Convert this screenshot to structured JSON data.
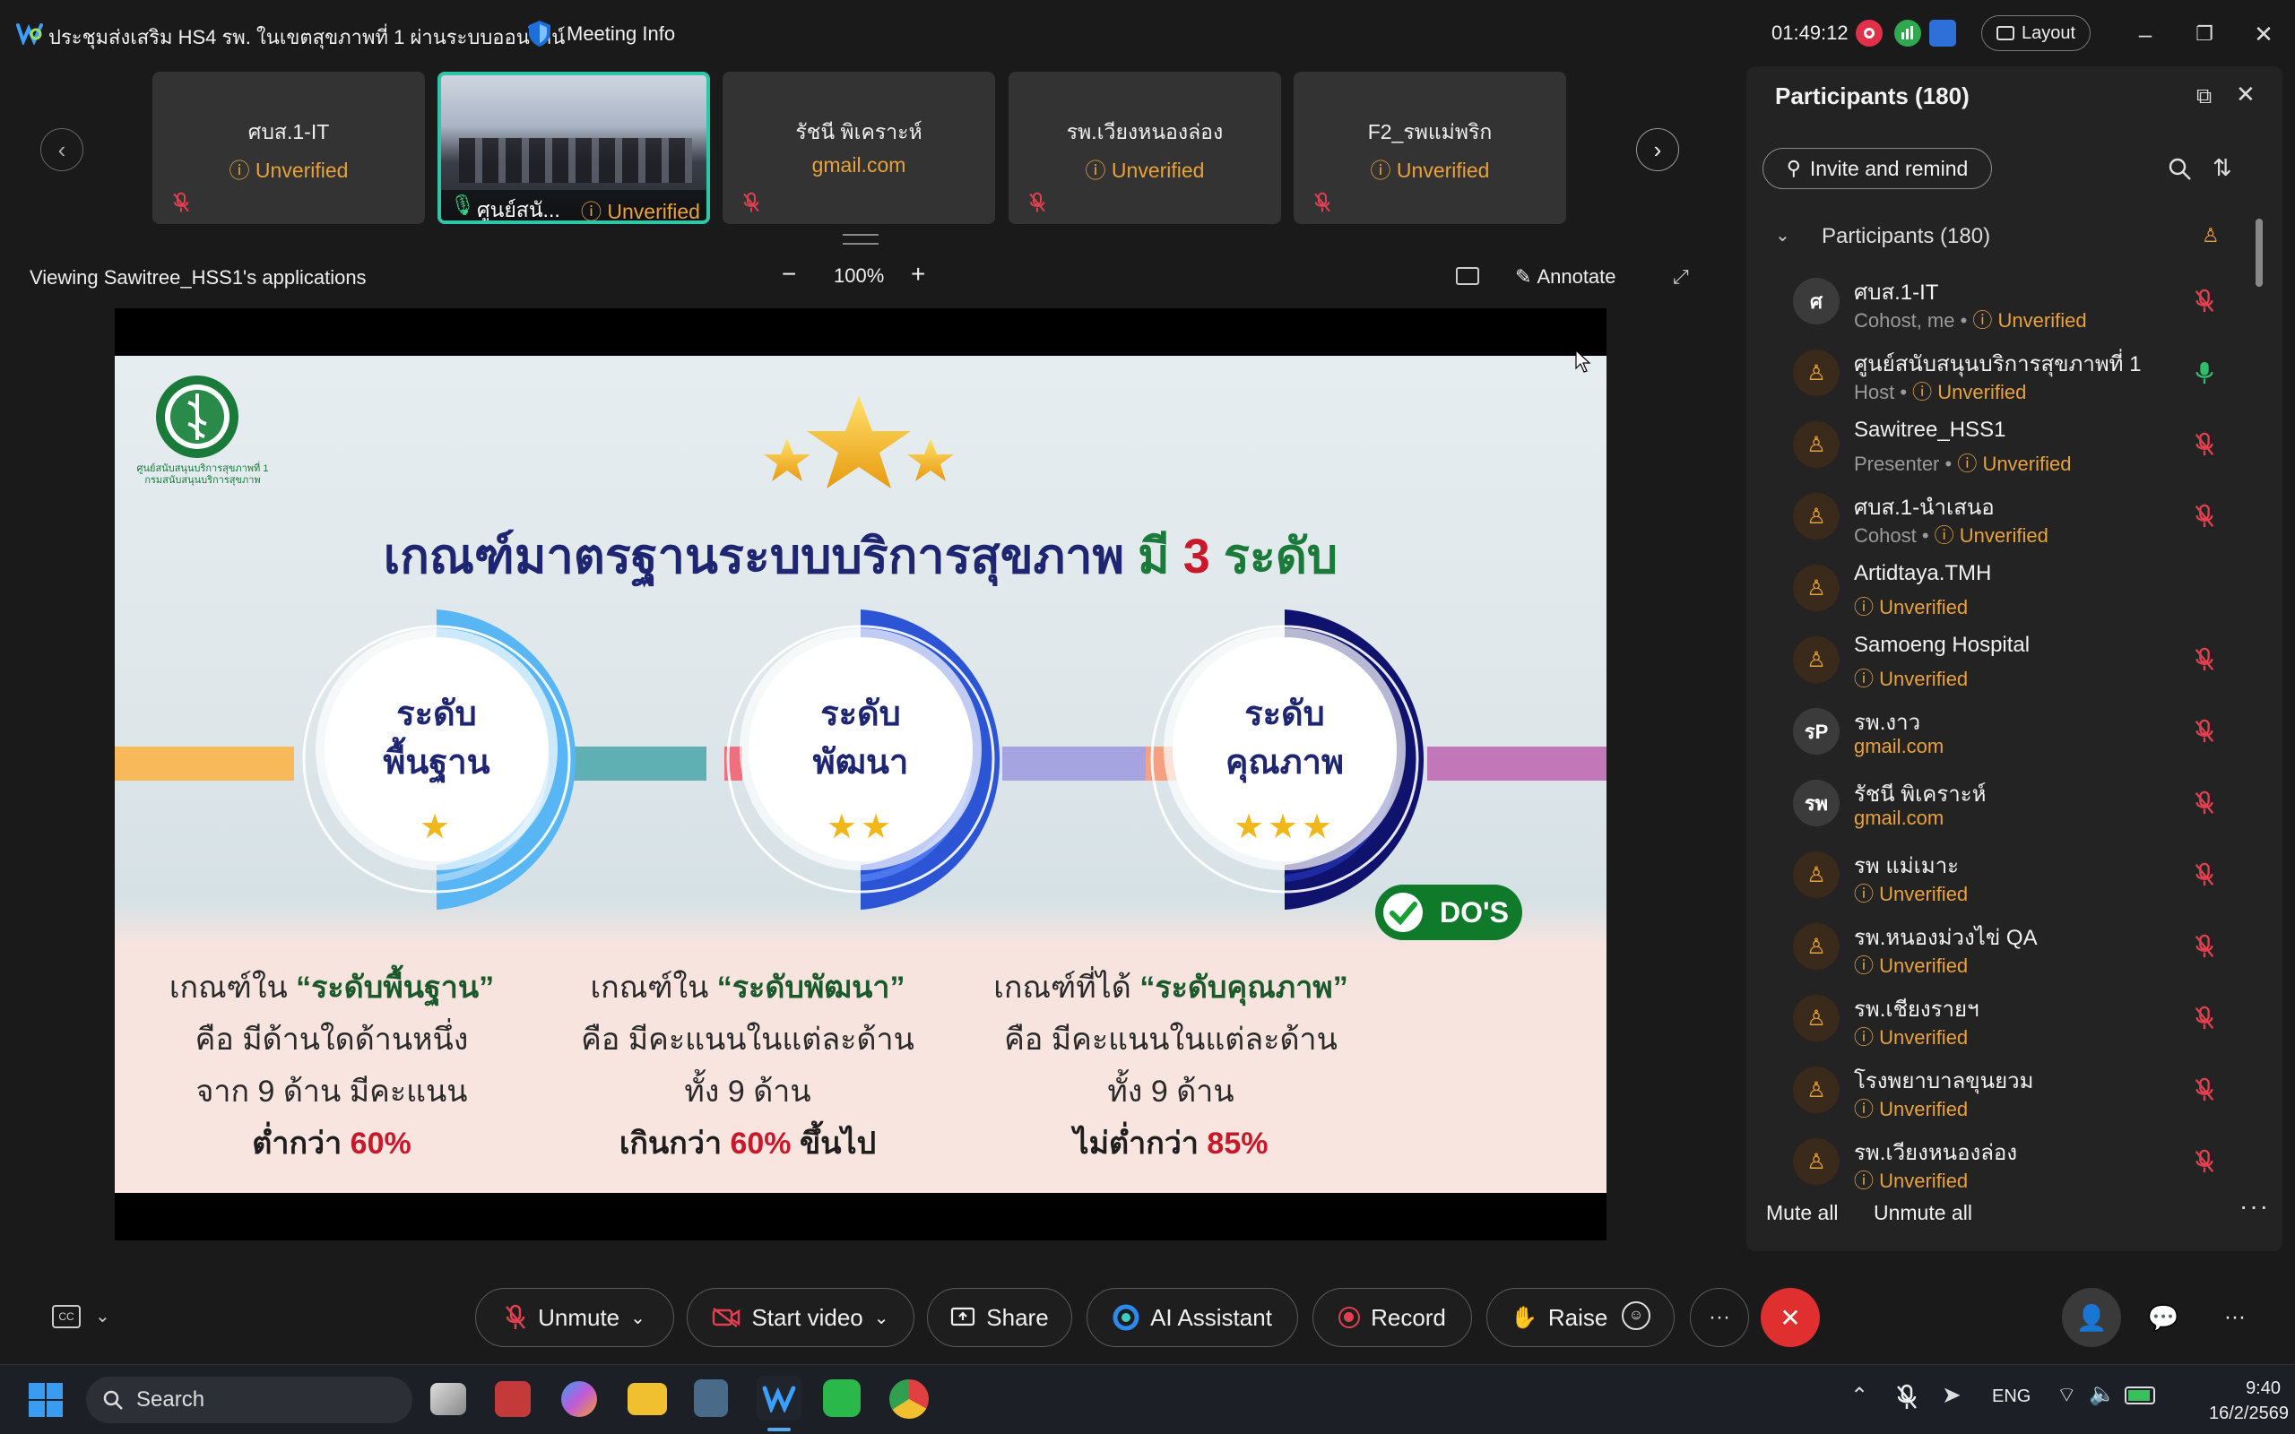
{
  "titlebar": {
    "meeting_title": "ประชุมส่งเสริม HS4 รพ. ในเขตสุขภาพที่ 1 ผ่านระบบออนไลน์",
    "meeting_info": "Meeting Info",
    "clock": "01:49:12",
    "layout_label": "Layout"
  },
  "thumbnails": [
    {
      "name": "ศบส.1-IT",
      "sub": "Unverified",
      "sub_type": "warn"
    },
    {
      "name": "ศูนย์สนั...",
      "sub": "Unverified",
      "sub_type": "warn",
      "active": true
    },
    {
      "name": "รัชนี พิเคราะห์",
      "sub": "gmail.com",
      "sub_type": "mail"
    },
    {
      "name": "รพ.เวียงหนองล่อง",
      "sub": "Unverified",
      "sub_type": "warn"
    },
    {
      "name": "F2_รพแม่พริก",
      "sub": "Unverified",
      "sub_type": "warn"
    }
  ],
  "viewing": {
    "label": "Viewing Sawitree_HSS1's applications",
    "zoom": "100%",
    "annotate": "Annotate"
  },
  "slide": {
    "logo_text_1": "ศูนย์สนับสนุนบริการสุขภาพที่ 1",
    "logo_text_2": "กรมสนับสนุนบริการสุขภาพ",
    "title_prefix": "เกณฑ์มาตรฐานระบบบริการสุขภาพ",
    "title_mid": "มี",
    "title_num": "3",
    "title_suffix": "ระดับ",
    "levels": [
      {
        "line1": "ระดับ",
        "line2": "พื้นฐาน",
        "stars": "★",
        "d1a": "เกณฑ์ใน ",
        "d1b": "“ระดับพื้นฐาน”",
        "d2": "คือ มีด้านใดด้านหนึ่ง",
        "d3": "จาก 9 ด้าน มีคะแนน",
        "d4a": "ต่ำกว่า ",
        "d4b": "60%",
        "d4c": ""
      },
      {
        "line1": "ระดับ",
        "line2": "พัฒนา",
        "stars": "★★",
        "d1a": "เกณฑ์ใน ",
        "d1b": "“ระดับพัฒนา”",
        "d2": "คือ มีคะแนนในแต่ละด้าน",
        "d3": "ทั้ง 9 ด้าน",
        "d4a": "เกินกว่า ",
        "d4b": "60%",
        "d4c": " ขึ้นไป"
      },
      {
        "line1": "ระดับ",
        "line2": "คุณภาพ",
        "stars": "★★★",
        "d1a": "เกณฑ์ที่ได้ ",
        "d1b": "“ระดับคุณภาพ”",
        "d2": "คือ มีคะแนนในแต่ละด้าน",
        "d3": "ทั้ง 9 ด้าน",
        "d4a": "ไม่ต่ำกว่า ",
        "d4b": "85%",
        "d4c": ""
      }
    ],
    "badge": "DO'S"
  },
  "panel": {
    "title": "Participants (180)",
    "invite": "Invite and remind",
    "section": "Participants (180)",
    "participants": [
      {
        "avatar": "ศ",
        "name": "ศบส.1-IT",
        "role": "Cohost, me • ",
        "sub": "Unverified",
        "sub_type": "warn",
        "mic": "muted"
      },
      {
        "avatar": "",
        "name": "ศูนย์สนับสนุนบริการสุขภาพที่ 1",
        "role": "Host • ",
        "sub": "Unverified",
        "sub_type": "warn",
        "mic": "on"
      },
      {
        "avatar": "",
        "name": "Sawitree_HSS1",
        "role": "Presenter • ",
        "sub": "Unverified",
        "sub_type": "warn",
        "mic": "muted"
      },
      {
        "avatar": "",
        "name": "ศบส.1-นำเสนอ",
        "role": "Cohost • ",
        "sub": "Unverified",
        "sub_type": "warn",
        "mic": "muted"
      },
      {
        "avatar": "",
        "name": "Artidtaya.TMH",
        "role": "",
        "sub": "Unverified",
        "sub_type": "warn",
        "mic": "none"
      },
      {
        "avatar": "",
        "name": "Samoeng Hospital",
        "role": "",
        "sub": "Unverified",
        "sub_type": "warn",
        "mic": "muted"
      },
      {
        "avatar": "รP",
        "name": "รพ.งาว",
        "role": "",
        "sub": "gmail.com",
        "sub_type": "mail",
        "mic": "muted"
      },
      {
        "avatar": "รพ",
        "name": "รัชนี พิเคราะห์",
        "role": "",
        "sub": "gmail.com",
        "sub_type": "mail",
        "mic": "muted"
      },
      {
        "avatar": "",
        "name": "รพ แม่เมาะ",
        "role": "",
        "sub": "Unverified",
        "sub_type": "warn",
        "mic": "muted"
      },
      {
        "avatar": "",
        "name": "รพ.หนองม่วงไข่ QA",
        "role": "",
        "sub": "Unverified",
        "sub_type": "warn",
        "mic": "muted"
      },
      {
        "avatar": "",
        "name": "รพ.เชียงรายฯ",
        "role": "",
        "sub": "Unverified",
        "sub_type": "warn",
        "mic": "muted"
      },
      {
        "avatar": "",
        "name": "โรงพยาบาลขุนยวม",
        "role": "",
        "sub": "Unverified",
        "sub_type": "warn",
        "mic": "muted"
      },
      {
        "avatar": "",
        "name": "รพ.เวียงหนองล่อง",
        "role": "",
        "sub": "Unverified",
        "sub_type": "warn",
        "mic": "muted"
      }
    ],
    "mute_all": "Mute all",
    "unmute_all": "Unmute all"
  },
  "toolbar": {
    "unmute": "Unmute",
    "start_video": "Start video",
    "share": "Share",
    "ai_assistant": "AI Assistant",
    "record": "Record",
    "raise": "Raise"
  },
  "taskbar": {
    "search": "Search",
    "lang": "ENG",
    "time": "9:40",
    "date": "16/2/2569"
  },
  "colors": {
    "accent_teal": "#2dc7a8",
    "warn_orange": "#e8a23a",
    "end_red": "#e02f2f",
    "slide_title_blue": "#1e2672"
  }
}
